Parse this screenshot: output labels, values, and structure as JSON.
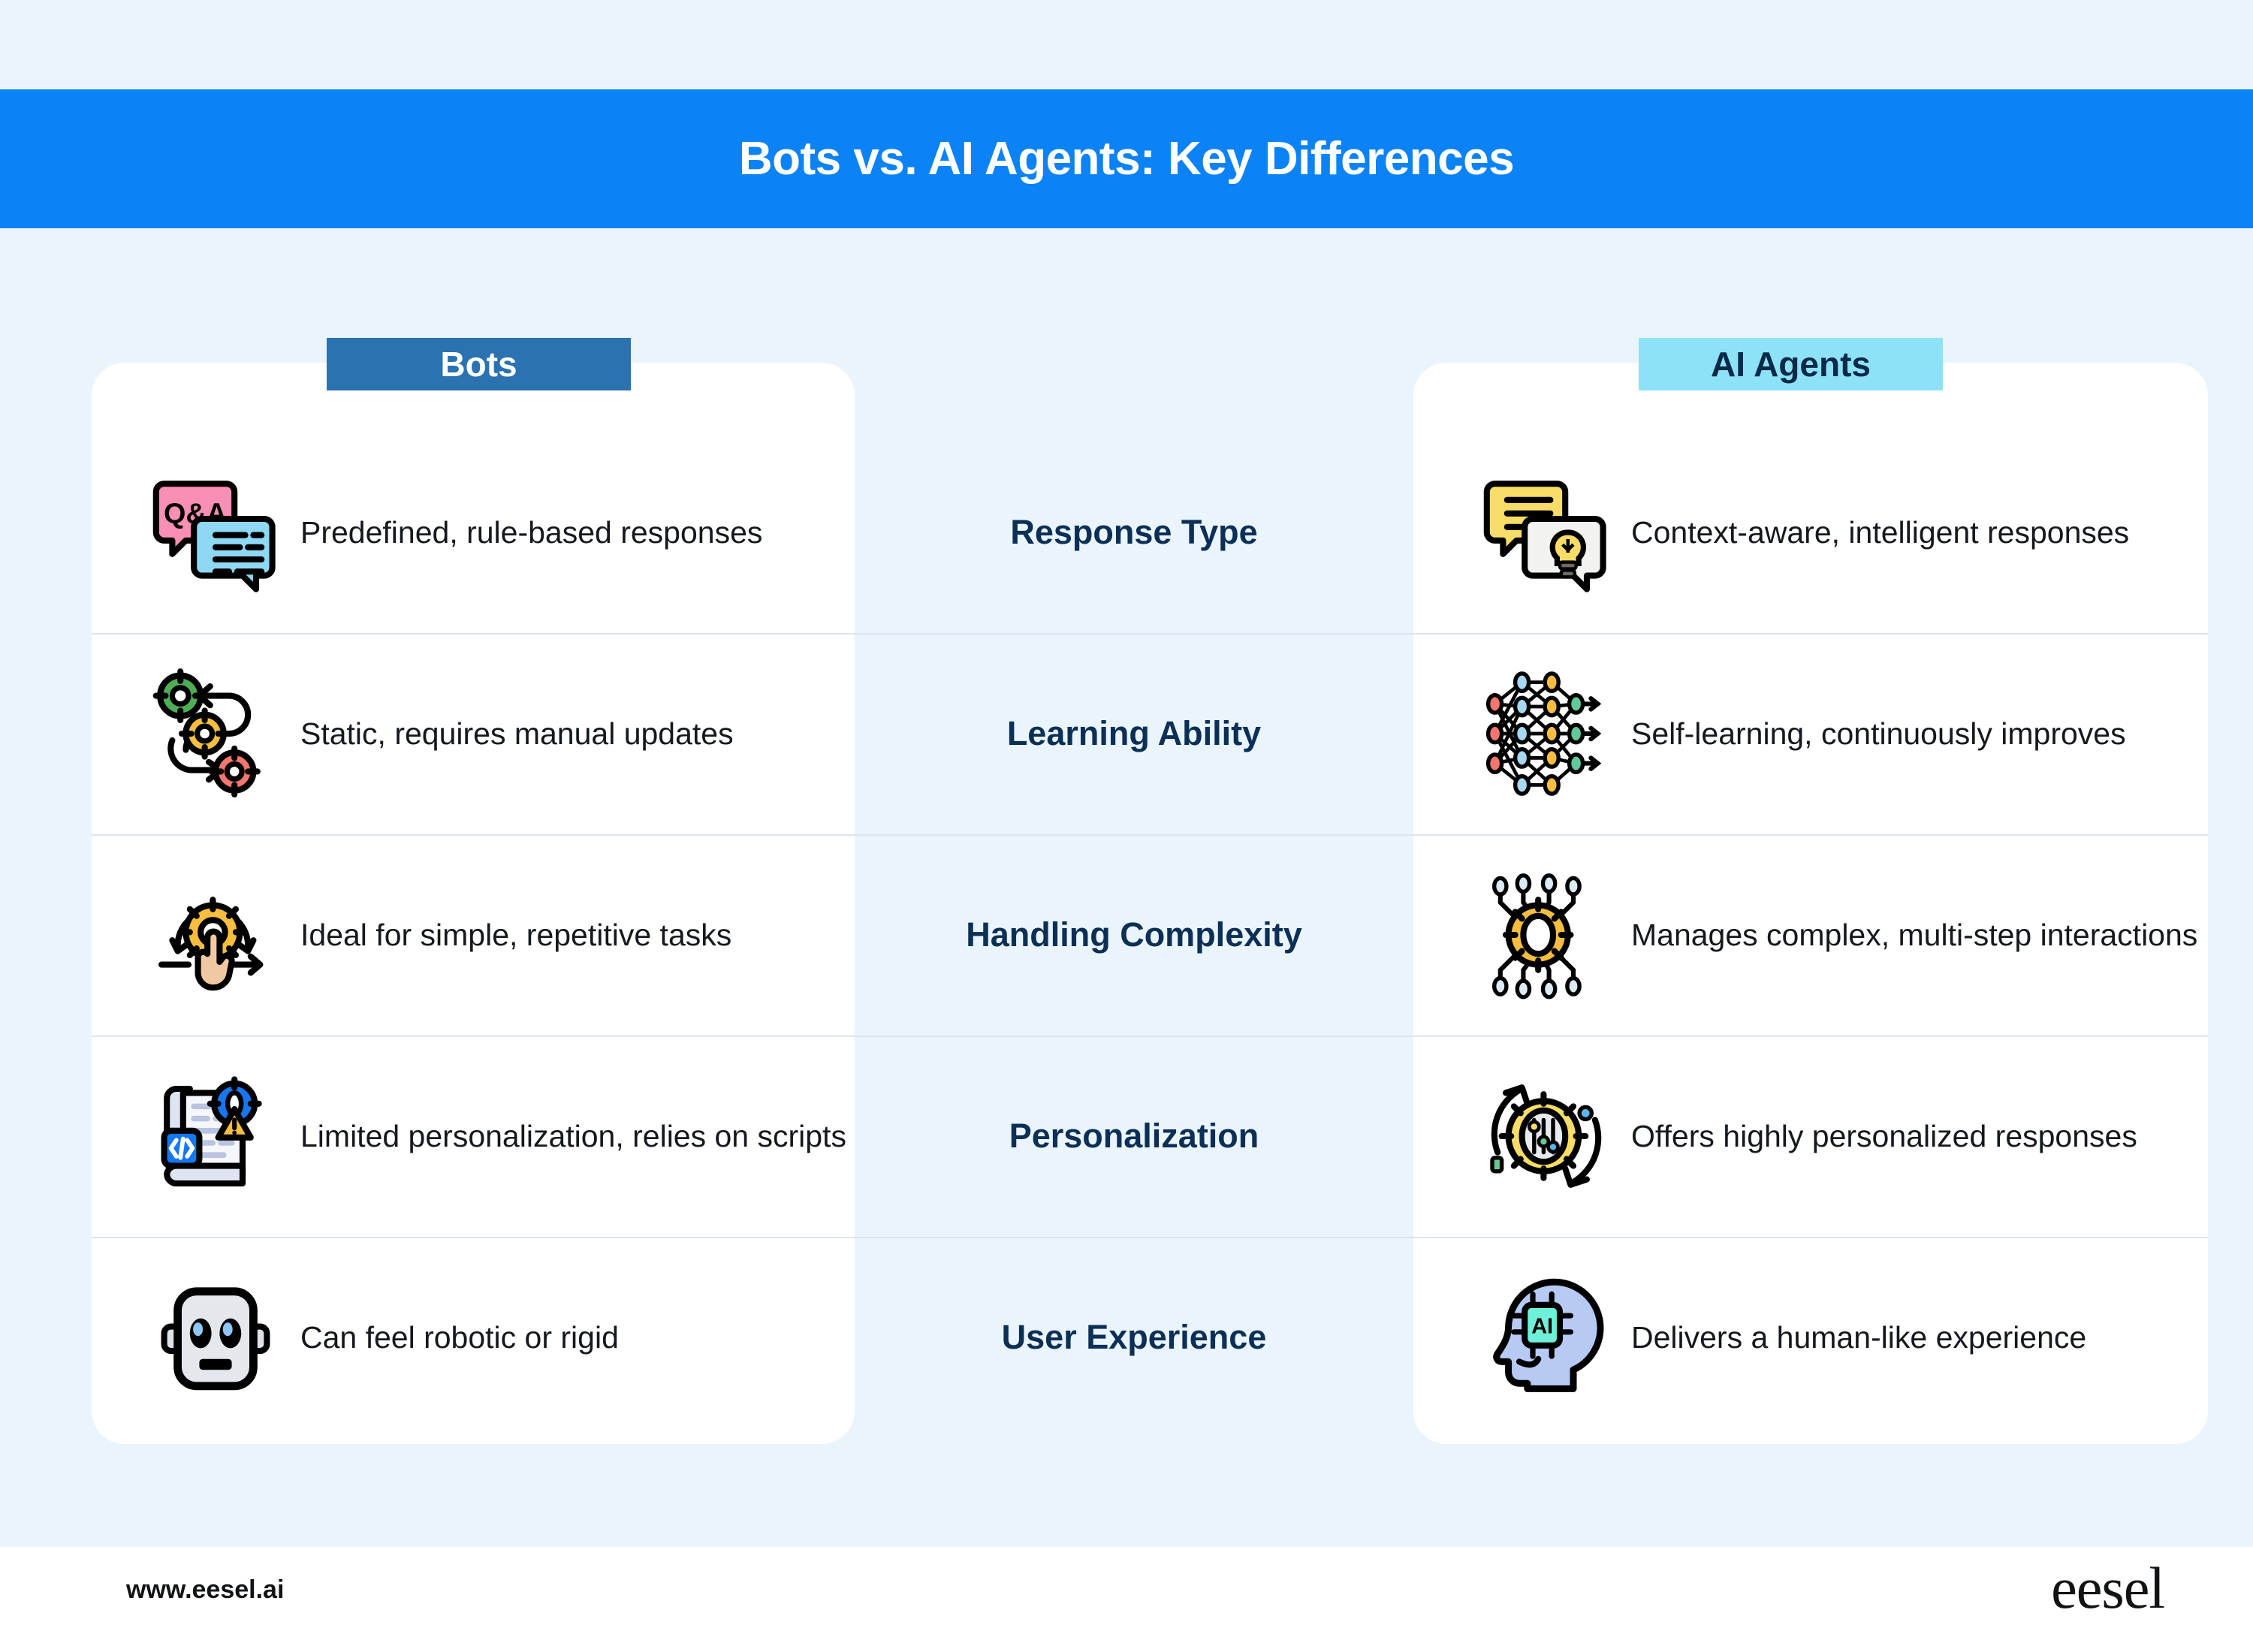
{
  "header": {
    "title": "Bots vs. AI Agents: Key Differences",
    "bg_color": "#0b82f5",
    "text_color": "#ffffff"
  },
  "columns": {
    "left_badge": "Bots",
    "left_badge_bg": "#2b72b0",
    "left_badge_text_color": "#ffffff",
    "right_badge": "AI Agents",
    "right_badge_bg": "#8ee2f7",
    "right_badge_text_color": "#0a2a4a"
  },
  "page_bg": "#eaf4fd",
  "rows": [
    {
      "attribute": "Response Type",
      "bot_icon": "qa-speech-bubbles-icon",
      "bot_text": "Predefined, rule-based responses",
      "agent_icon": "lightbulb-speech-bubbles-icon",
      "agent_text": "Context-aware, intelligent responses"
    },
    {
      "attribute": "Learning Ability",
      "bot_icon": "gears-loop-arrows-icon",
      "bot_text": "Static, requires manual updates",
      "agent_icon": "neural-network-icon",
      "agent_text": "Self-learning, continuously improves"
    },
    {
      "attribute": "Handling Complexity",
      "bot_icon": "gear-hand-click-icon",
      "bot_text": "Ideal for simple, repetitive tasks",
      "agent_icon": "gear-circuit-nodes-icon",
      "agent_text": "Manages complex, multi-step interactions"
    },
    {
      "attribute": "Personalization",
      "bot_icon": "script-code-warning-icon",
      "bot_text": "Limited personalization, relies on scripts",
      "agent_icon": "gear-sliders-refresh-icon",
      "agent_text": "Offers highly personalized responses"
    },
    {
      "attribute": "User Experience",
      "bot_icon": "robot-head-icon",
      "bot_text": "Can feel robotic or rigid",
      "agent_icon": "head-ai-chip-icon",
      "agent_text": "Delivers a human-like experience"
    }
  ],
  "footer": {
    "url": "www.eesel.ai",
    "logo": "eesel"
  }
}
